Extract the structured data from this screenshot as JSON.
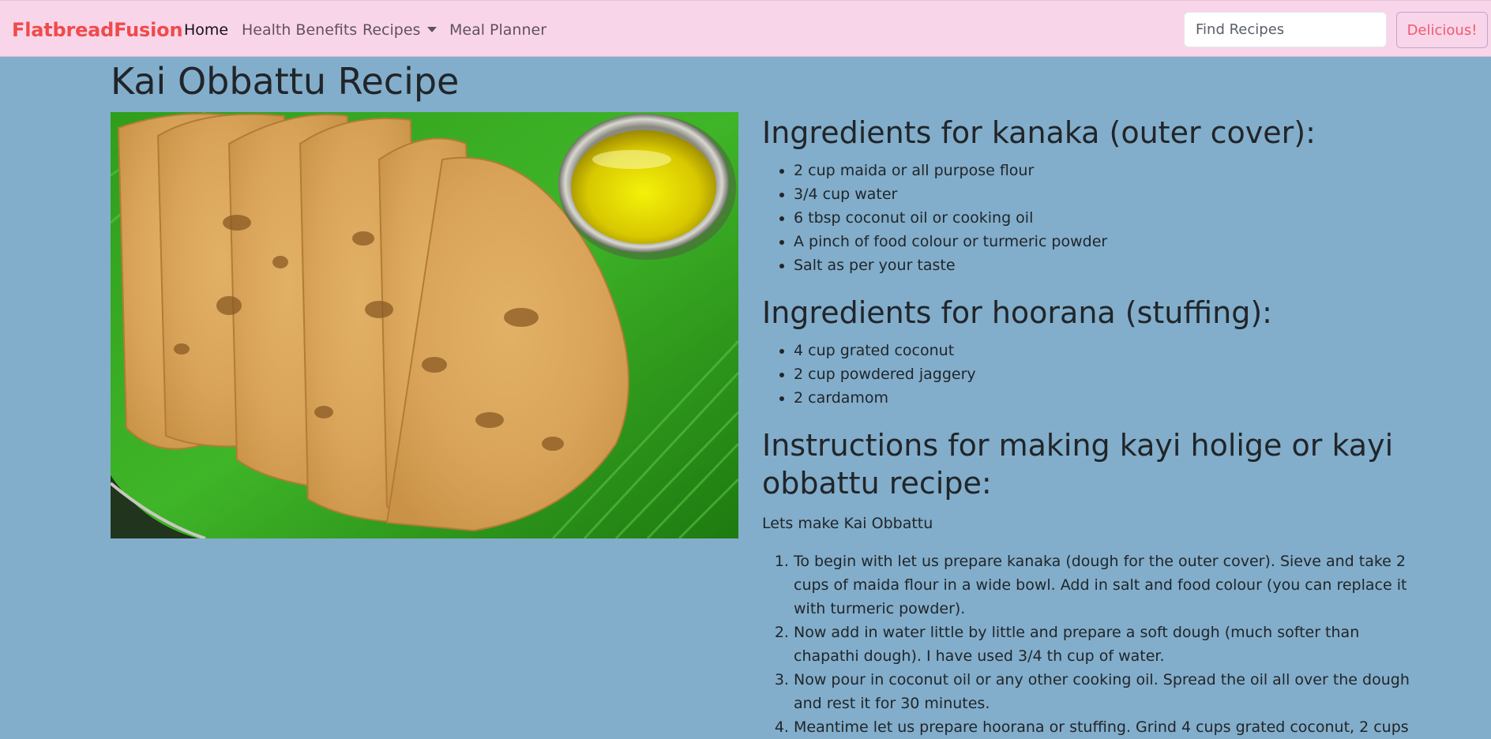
{
  "nav": {
    "brand": "FlatbreadFusion",
    "items": [
      {
        "label": "Home",
        "active": true
      },
      {
        "label": "Health Benefits"
      },
      {
        "label": "Recipes",
        "dropdown": true
      },
      {
        "label": "Meal Planner"
      }
    ],
    "search_placeholder": "Find Recipes",
    "search_button": "Delicious!"
  },
  "page": {
    "title": "Kai Obbattu Recipe"
  },
  "kanaka": {
    "heading": "Ingredients for kanaka (outer cover):",
    "items": [
      "2 cup maida or all purpose flour",
      "3/4 cup water",
      "6 tbsp coconut oil or cooking oil",
      "A pinch of food colour or turmeric powder",
      "Salt as per your taste"
    ]
  },
  "hoorana": {
    "heading": "Ingredients for hoorana (stuffing):",
    "items": [
      "4 cup grated coconut",
      "2 cup powdered jaggery",
      "2 cardamom"
    ]
  },
  "instructions": {
    "heading": "Instructions for making kayi holige or kayi obbattu recipe:",
    "intro": "Lets make Kai Obbattu",
    "steps": [
      "To begin with let us prepare kanaka (dough for the outer cover). Sieve and take 2 cups of maida flour in a wide bowl. Add in salt and food colour (you can replace it with turmeric powder).",
      "Now add in water little by little and prepare a soft dough (much softer than chapathi dough). I have used 3/4 th cup of water.",
      "Now pour in coconut oil or any other cooking oil. Spread the oil all over the dough and rest it for 30 minutes.",
      "Meantime let us prepare hoorana or stuffing. Grind 4 cups grated coconut, 2 cups"
    ]
  },
  "colors": {
    "background": "#82aecb",
    "navbar": "#f9d5ea",
    "brand": "#ef4b4b",
    "button_text": "#ef5a6d"
  }
}
